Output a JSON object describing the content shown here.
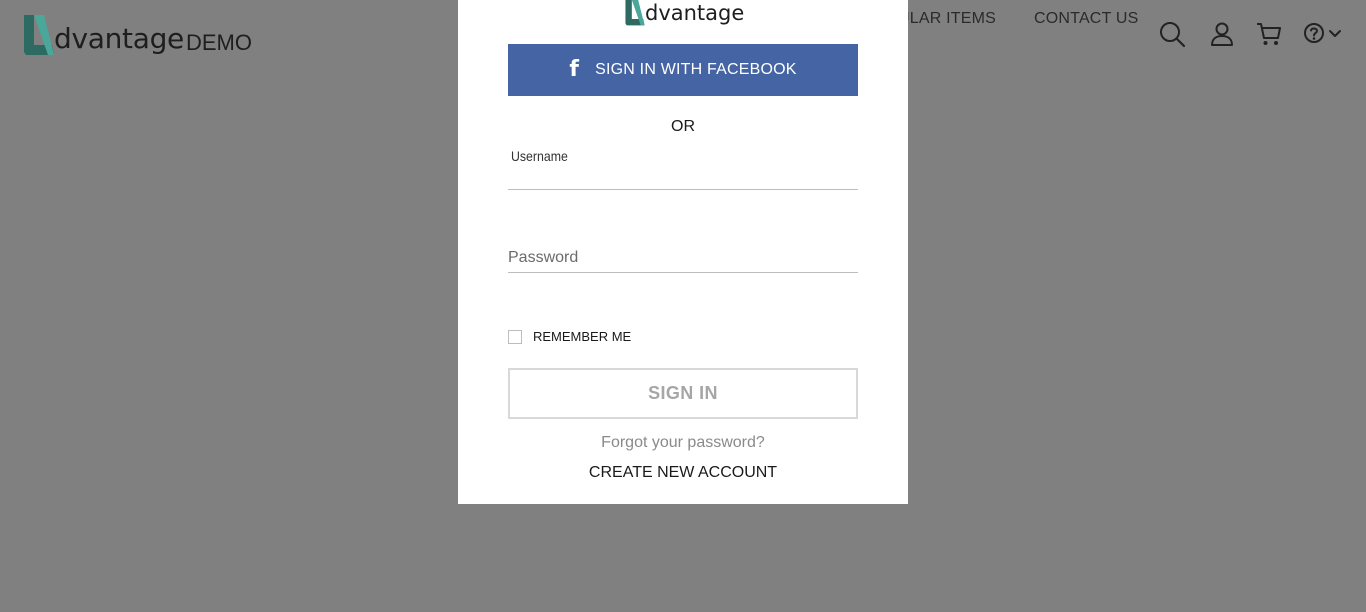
{
  "header": {
    "logo_word": "dvantage",
    "logo_suffix": "DEMO",
    "nav": {
      "popular_items": "ULAR ITEMS",
      "contact_us": "CONTACT US"
    },
    "icons": [
      "search-icon",
      "user-icon",
      "cart-icon",
      "help-icon",
      "chevron-down-icon"
    ]
  },
  "modal": {
    "logo_word": "dvantage",
    "facebook_button": "SIGN IN WITH FACEBOOK",
    "facebook_icon": "f",
    "or_text": "OR",
    "username_label": "Username",
    "username_value": "",
    "password_placeholder": "Password",
    "remember_me": "REMEMBER ME",
    "sign_in_button": "SIGN IN",
    "forgot_password": "Forgot your password?",
    "create_account": "CREATE NEW ACCOUNT"
  },
  "colors": {
    "overlay_background": "#808080",
    "facebook_blue": "#4464a4",
    "logo_teal": "#4aa79a",
    "disabled_text": "#a6a6a6"
  }
}
